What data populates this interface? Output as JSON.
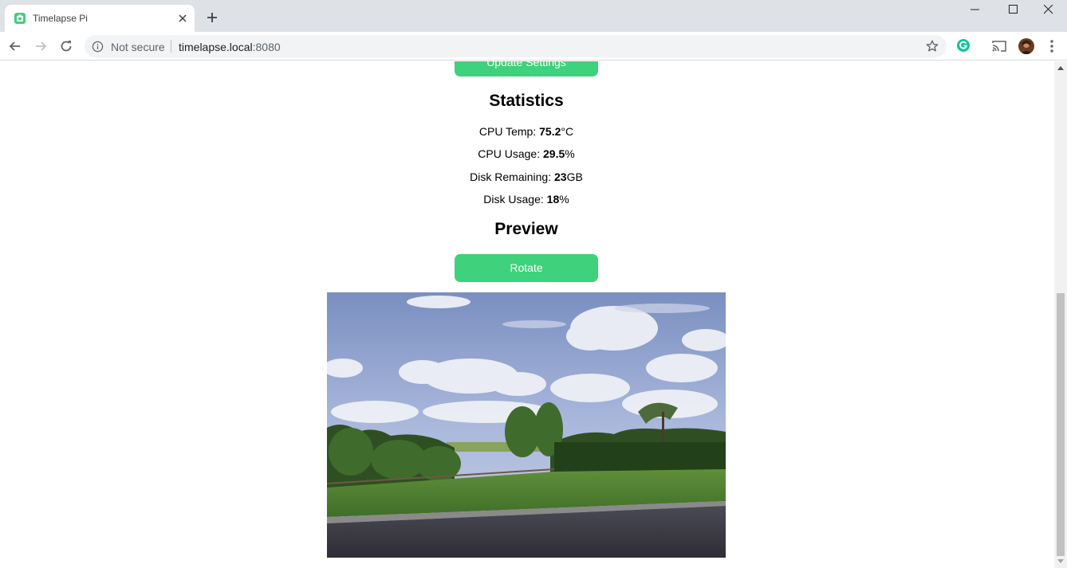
{
  "browser": {
    "tab_title": "Timelapse Pi",
    "security_label": "Not secure",
    "url_host": "timelapse.local",
    "url_port": ":8080"
  },
  "page": {
    "update_button": "Update Settings",
    "statistics_heading": "Statistics",
    "stats": [
      {
        "label": "CPU Temp: ",
        "value": "75.2",
        "unit": "°C"
      },
      {
        "label": "CPU Usage: ",
        "value": "29.5",
        "unit": "%"
      },
      {
        "label": "Disk Remaining: ",
        "value": "23",
        "unit": "GB"
      },
      {
        "label": "Disk Usage: ",
        "value": "18",
        "unit": "%"
      }
    ],
    "preview_heading": "Preview",
    "rotate_button": "Rotate"
  },
  "colors": {
    "accent": "#3dd27b",
    "favicon": "#3dd27b"
  }
}
